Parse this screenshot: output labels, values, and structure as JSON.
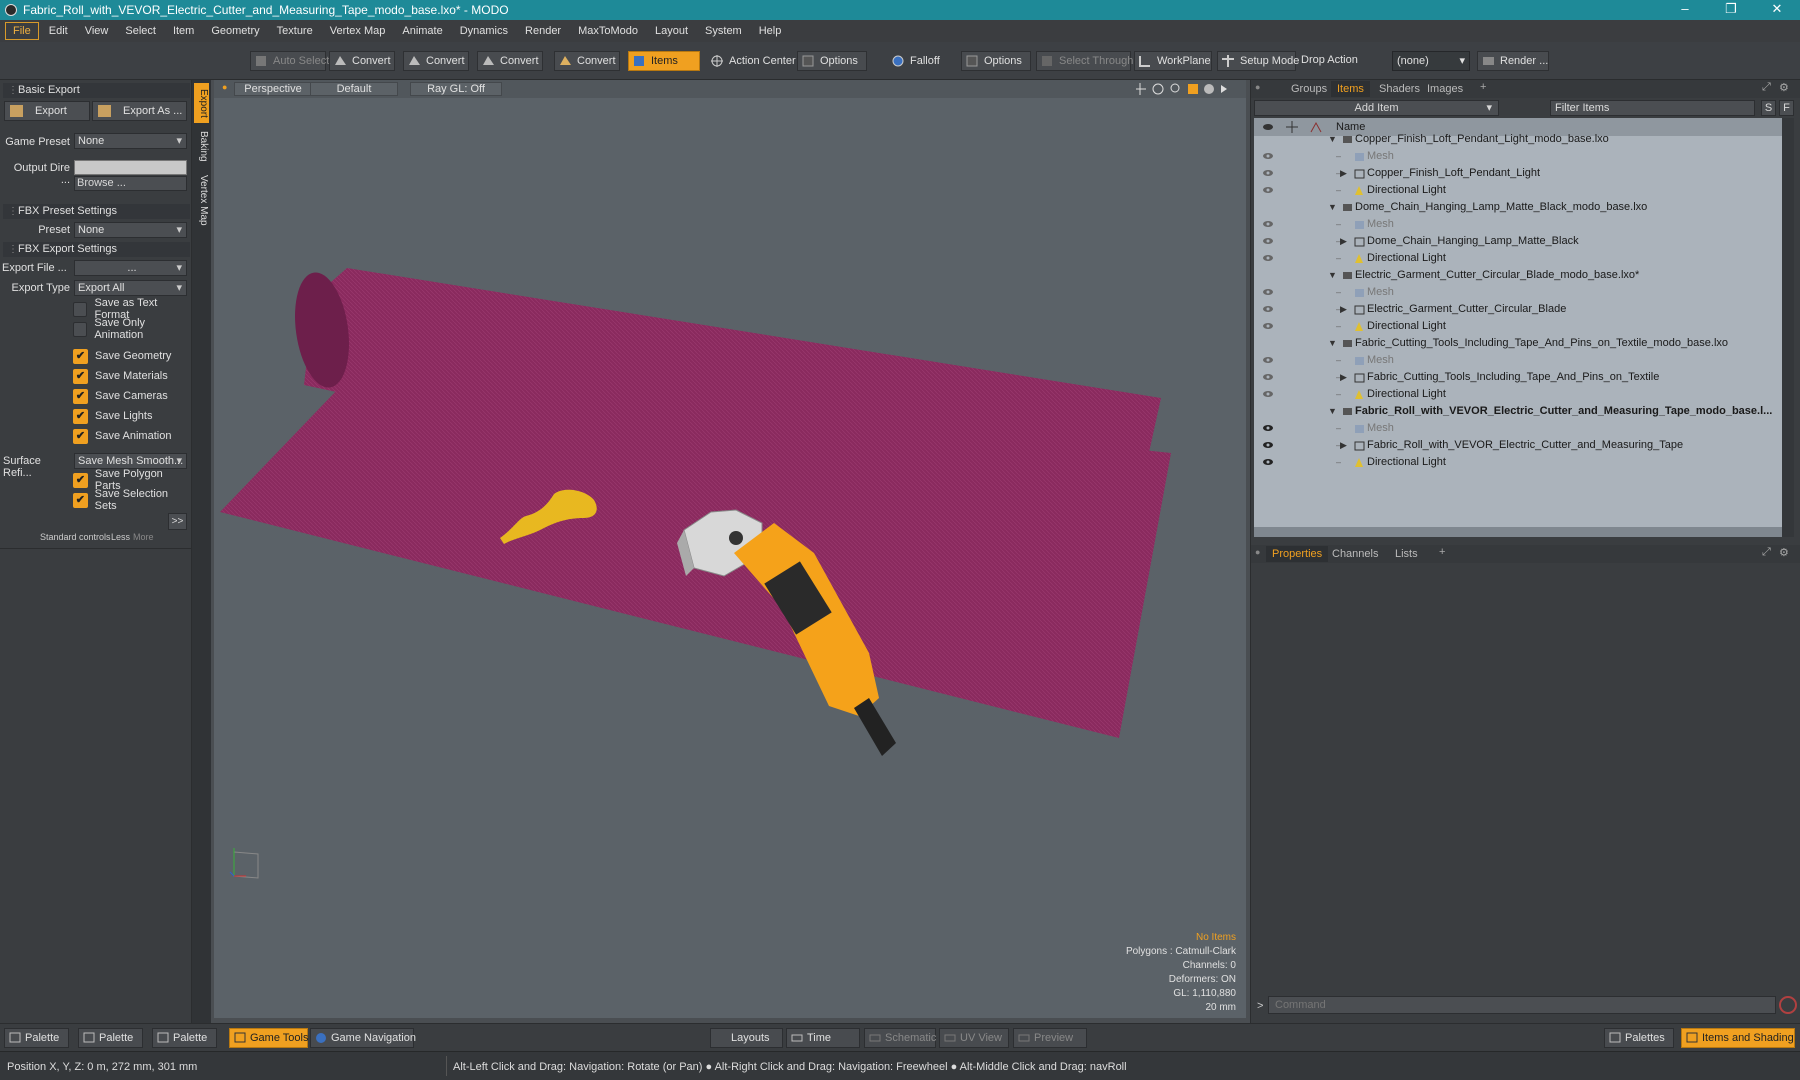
{
  "window": {
    "title": "Fabric_Roll_with_VEVOR_Electric_Cutter_and_Measuring_Tape_modo_base.lxo* - MODO",
    "minimize": "–",
    "restore": "❐",
    "close": "✕"
  },
  "menu": [
    "File",
    "Edit",
    "View",
    "Select",
    "Item",
    "Geometry",
    "Texture",
    "Vertex Map",
    "Animate",
    "Dynamics",
    "Render",
    "MaxToModo",
    "Layout",
    "System",
    "Help"
  ],
  "toolbar": {
    "auto_select": "Auto Select",
    "convert1": "Convert",
    "convert2": "Convert",
    "convert3": "Convert",
    "convert4": "Convert",
    "items": "Items",
    "action_center": "Action Center",
    "options1": "Options",
    "falloff": "Falloff",
    "options2": "Options",
    "select_through": "Select Through",
    "workplane": "WorkPlane",
    "setup_mode": "Setup Mode",
    "drop_action_label": "Drop Action",
    "drop_action_value": "(none)",
    "render": "Render ..."
  },
  "left_panel": {
    "basic_export": "Basic Export",
    "export_btn": "Export",
    "export_as_btn": "Export As ...",
    "game_preset_label": "Game Preset",
    "game_preset_value": "None",
    "output_dir_label": "Output Dire ...",
    "browse": "Browse ...",
    "fbx_preset_settings": "FBX Preset Settings",
    "preset_label": "Preset",
    "preset_value": "None",
    "fbx_export_settings": "FBX Export Settings",
    "export_file_label": "Export File ...",
    "export_file_value": "...",
    "export_type_label": "Export Type",
    "export_type_value": "Export All",
    "checkboxes": [
      {
        "label": "Save as Text Format",
        "checked": false
      },
      {
        "label": "Save Only Animation",
        "checked": false
      },
      {
        "label": "Save Geometry",
        "checked": true
      },
      {
        "label": "Save Materials",
        "checked": true
      },
      {
        "label": "Save Cameras",
        "checked": true
      },
      {
        "label": "Save Lights",
        "checked": true
      },
      {
        "label": "Save Animation",
        "checked": true
      }
    ],
    "surface_ref_label": "Surface Refi...",
    "surface_ref_value": "Save Mesh Smooth...",
    "checkboxes2": [
      {
        "label": "Save Polygon Parts",
        "checked": true
      },
      {
        "label": "Save Selection Sets",
        "checked": true
      }
    ],
    "more_btn": ">>",
    "standard_controls": "Standard controls",
    "less": "Less",
    "more": "More"
  },
  "vertical_tabs": [
    "Export",
    "Baking",
    "Vertex Map"
  ],
  "viewport": {
    "perspective": "Perspective",
    "default": "Default",
    "raygl": "Ray GL: Off",
    "info": {
      "no_items": "No Items",
      "polygons": "Polygons : Catmull-Clark",
      "channels": "Channels: 0",
      "deformers": "Deformers: ON",
      "gl": "GL: 1,110,880",
      "scale": "20 mm"
    },
    "colors": {
      "fabric": "#8a2a5e",
      "fabric_dark": "#6d1f4b",
      "cutter": "#f5a21a",
      "background": "#5b6268"
    }
  },
  "right_panel": {
    "tabs": [
      "Groups",
      "Items",
      "Shaders",
      "Images"
    ],
    "add_item": "Add Item",
    "filter_items": "Filter Items",
    "s_btn": "S",
    "f_btn": "F",
    "name_col": "Name",
    "items": [
      {
        "level": 0,
        "type": "scene",
        "name": "Copper_Finish_Loft_Pendant_Light_modo_base.lxo",
        "expanded": true,
        "bold": false
      },
      {
        "level": 1,
        "type": "mesh",
        "name": "Mesh",
        "dim": true
      },
      {
        "level": 1,
        "type": "group",
        "name": "Copper_Finish_Loft_Pendant_Light",
        "collapsed": true
      },
      {
        "level": 1,
        "type": "light",
        "name": "Directional Light"
      },
      {
        "level": 0,
        "type": "scene",
        "name": "Dome_Chain_Hanging_Lamp_Matte_Black_modo_base.lxo",
        "expanded": true
      },
      {
        "level": 1,
        "type": "mesh",
        "name": "Mesh",
        "dim": true
      },
      {
        "level": 1,
        "type": "group",
        "name": "Dome_Chain_Hanging_Lamp_Matte_Black",
        "collapsed": true
      },
      {
        "level": 1,
        "type": "light",
        "name": "Directional Light"
      },
      {
        "level": 0,
        "type": "scene",
        "name": "Electric_Garment_Cutter_Circular_Blade_modo_base.lxo*",
        "expanded": true
      },
      {
        "level": 1,
        "type": "mesh",
        "name": "Mesh",
        "dim": true
      },
      {
        "level": 1,
        "type": "group",
        "name": "Electric_Garment_Cutter_Circular_Blade",
        "collapsed": true
      },
      {
        "level": 1,
        "type": "light",
        "name": "Directional Light"
      },
      {
        "level": 0,
        "type": "scene",
        "name": "Fabric_Cutting_Tools_Including_Tape_And_Pins_on_Textile_modo_base.lxo",
        "expanded": true
      },
      {
        "level": 1,
        "type": "mesh",
        "name": "Mesh",
        "dim": true
      },
      {
        "level": 1,
        "type": "group",
        "name": "Fabric_Cutting_Tools_Including_Tape_And_Pins_on_Textile",
        "collapsed": true
      },
      {
        "level": 1,
        "type": "light",
        "name": "Directional Light"
      },
      {
        "level": 0,
        "type": "scene",
        "name": "Fabric_Roll_with_VEVOR_Electric_Cutter_and_Measuring_Tape_modo_base.l...",
        "expanded": true,
        "bold": true
      },
      {
        "level": 1,
        "type": "mesh",
        "name": "Mesh",
        "dim": true
      },
      {
        "level": 1,
        "type": "group",
        "name": "Fabric_Roll_with_VEVOR_Electric_Cutter_and_Measuring_Tape",
        "collapsed": true
      },
      {
        "level": 1,
        "type": "light",
        "name": "Directional Light"
      }
    ],
    "props_tabs": [
      "Properties",
      "Channels",
      "Lists"
    ],
    "command_placeholder": "Command",
    "command_prompt": ">"
  },
  "bottom_bar": {
    "palette1": "Palette",
    "palette2": "Palette",
    "palette3": "Palette",
    "game_tools": "Game Tools",
    "game_navigation": "Game Navigation",
    "layouts": "Layouts",
    "time": "Time",
    "schematic": "Schematic",
    "uv_view": "UV View",
    "preview": "Preview",
    "palettes": "Palettes",
    "items_and_shading": "Items and Shading"
  },
  "status_bar": {
    "position": "Position X, Y, Z:   0 m, 272 mm, 301 mm",
    "hint": "Alt-Left Click and Drag: Navigation: Rotate (or Pan) ● Alt-Right Click and Drag: Navigation: Freewheel ● Alt-Middle Click and Drag: navRoll"
  }
}
